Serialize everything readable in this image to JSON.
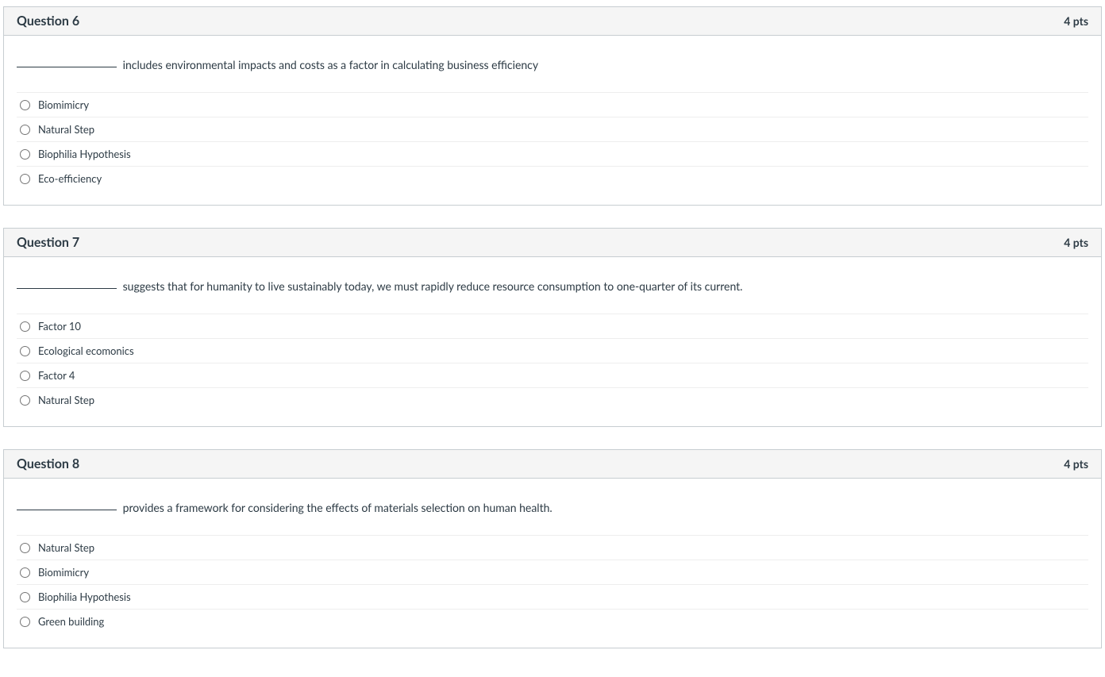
{
  "questions": [
    {
      "title": "Question 6",
      "points": "4 pts",
      "prompt": "includes environmental impacts and costs as a factor in calculating business efficiency",
      "answers": [
        "Biomimicry",
        "Natural Step",
        "Biophilia Hypothesis",
        "Eco-efficiency"
      ]
    },
    {
      "title": "Question 7",
      "points": "4 pts",
      "prompt": "suggests that for humanity to live sustainably today, we must rapidly reduce resource consumption to one-quarter of its current.",
      "answers": [
        "Factor 10",
        "Ecological ecomonics",
        "Factor 4",
        "Natural Step"
      ]
    },
    {
      "title": "Question 8",
      "points": "4 pts",
      "prompt": "provides a framework for considering the effects of materials selection on human health.",
      "answers": [
        "Natural Step",
        "Biomimicry",
        "Biophilia Hypothesis",
        "Green building"
      ]
    }
  ]
}
